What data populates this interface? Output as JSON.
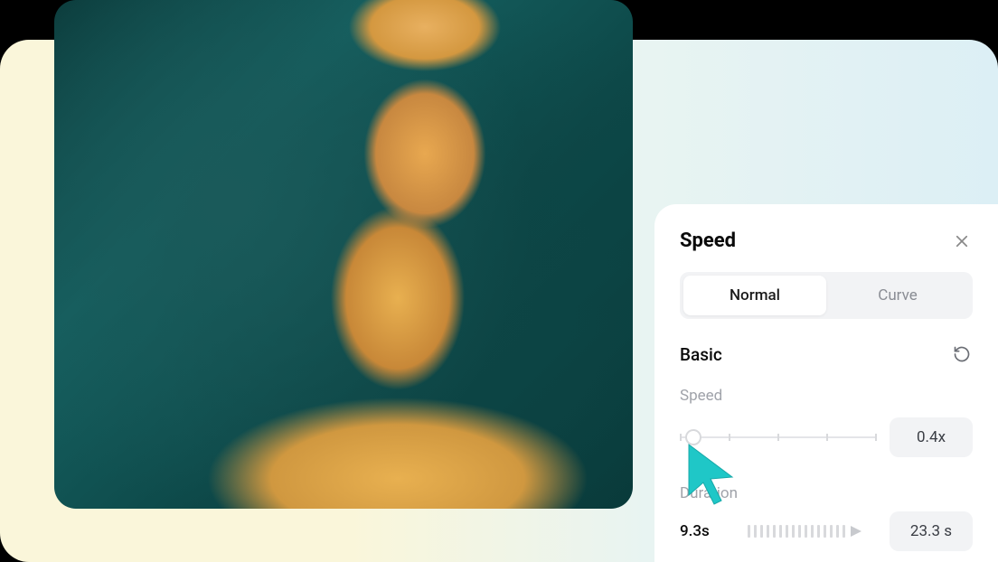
{
  "panel": {
    "title": "Speed",
    "tabs": {
      "normal": "Normal",
      "curve": "Curve"
    },
    "section": {
      "title": "Basic"
    },
    "speed": {
      "label": "Speed",
      "value": "0.4x",
      "thumb_pct": 7
    },
    "duration": {
      "label": "Duration",
      "start": "9.3s",
      "end": "23.3 s"
    }
  }
}
